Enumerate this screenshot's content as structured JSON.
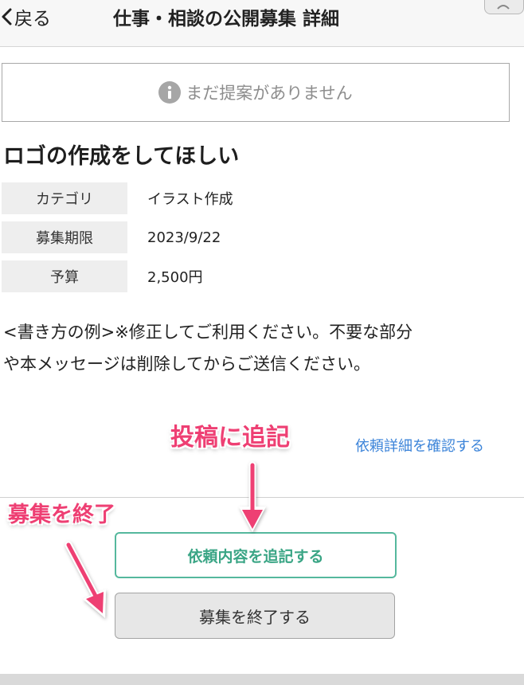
{
  "header": {
    "back_label": "戻る",
    "title": "仕事・相談の公開募集 詳細"
  },
  "notice": {
    "text": "まだ提案がありません",
    "icon": "info-icon"
  },
  "post": {
    "title": "ロゴの作成をしてほしい",
    "info": [
      {
        "label": "カテゴリ",
        "value": "イラスト作成"
      },
      {
        "label": "募集期限",
        "value": "2023/9/22"
      },
      {
        "label": "予算",
        "value": "2,500円"
      }
    ],
    "body_lines": [
      "<書き方の例>※修正してご利用ください。不要な部分",
      "や本メッセージは削除してからご送信ください。"
    ],
    "detail_link": "依頼詳細を確認する"
  },
  "actions": {
    "append_label": "依頼内容を追記する",
    "end_label": "募集を終了する"
  },
  "annotations": {
    "append_note": "投稿に追記",
    "end_note": "募集を終了",
    "color": "#ee3f73"
  },
  "colors": {
    "link": "#3c84d9",
    "accent_green": "#3aa585"
  }
}
